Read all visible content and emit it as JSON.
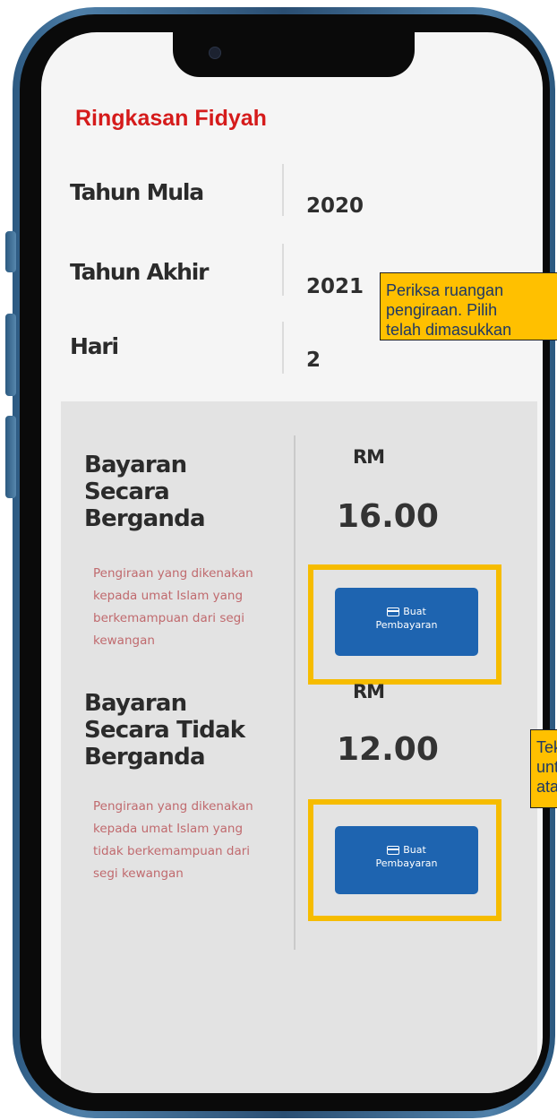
{
  "summary": {
    "title": "Ringkasan Fidyah",
    "rows": [
      {
        "label": "Tahun Mula",
        "value": "2020"
      },
      {
        "label": "Tahun Akhir",
        "value": "2021"
      },
      {
        "label": "Hari",
        "value": "2"
      }
    ]
  },
  "payments": [
    {
      "title": "Bayaran Secara Berganda",
      "description": "Pengiraan yang dikenakan kepada umat Islam yang berkemampuan dari segi kewangan",
      "currency": "RM",
      "amount": "16.00",
      "button_line1": "Buat",
      "button_line2": "Pembayaran"
    },
    {
      "title": "Bayaran Secara Tidak Berganda",
      "description": "Pengiraan yang dikenakan kepada umat Islam yang tidak berkemampuan dari segi kewangan",
      "currency": "RM",
      "amount": "12.00",
      "button_line1": "Buat",
      "button_line2": "Pembayaran"
    }
  ],
  "callouts": [
    {
      "lines": [
        "Periksa ruangan",
        "pengiraan. Pilih",
        "telah dimasukkan"
      ]
    },
    {
      "lines": [
        "Tekan",
        "untuk",
        "atas t"
      ]
    }
  ],
  "colors": {
    "title_red": "#d51b1b",
    "button_blue": "#1e64b0",
    "highlight_yellow": "#f6bc00",
    "callout_yellow": "#ffc000",
    "description_pink": "#c06a6e",
    "phone_frame_blue": "#3b6a94"
  },
  "icons": {
    "button_icon": "credit-card-icon"
  }
}
